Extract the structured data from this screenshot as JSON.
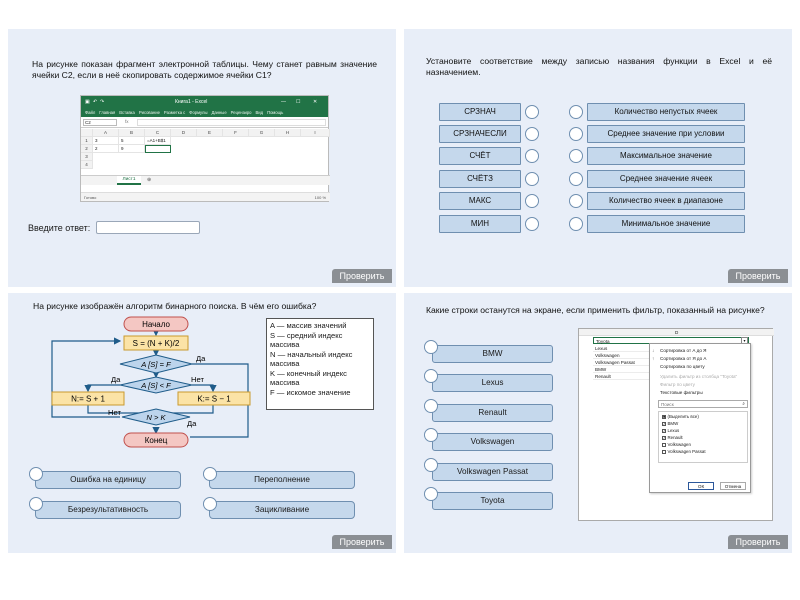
{
  "common": {
    "check_label": "Проверить"
  },
  "task1": {
    "question": "На рисунке показан фрагмент электронной таблицы. Чему станет равным значение ячейки C2, если в неё скопировать содержимое ячейки C1?",
    "excel": {
      "title": "Книга1 - Excel",
      "ribbon": [
        "Файл",
        "Главная",
        "Вставка",
        "Рисование",
        "Разметка с",
        "Формулы",
        "Данные",
        "Рецензиро",
        "Вид",
        "Помощь"
      ],
      "namebox": "C2",
      "fx": "fx",
      "columns": [
        "A",
        "B",
        "C",
        "D",
        "E",
        "F",
        "G",
        "H",
        "I"
      ],
      "rows": [
        "1",
        "2",
        "3",
        "4"
      ],
      "cells": {
        "a1": "3",
        "b1": "5",
        "c1": "=A1+B$1",
        "a2": "2",
        "b2": "9"
      },
      "sheet_tab": "Лист1",
      "status": "Готово",
      "zoom": "100 %"
    },
    "answer_label": "Введите ответ:",
    "answer_value": ""
  },
  "task2": {
    "question": "Установите соответствие между записью названия функции в Excel и её назначением.",
    "functions": [
      "СРЗНАЧ",
      "СРЗНАЧЕСЛИ",
      "СЧЁТ",
      "СЧЁТЗ",
      "МАКС",
      "МИН"
    ],
    "meanings": [
      "Количество непустых ячеек",
      "Среднее значение при условии",
      "Максимальное значение",
      "Среднее значение ячеек",
      "Количество ячеек в диапазоне",
      "Минимальное значение"
    ]
  },
  "task3": {
    "question": "На рисунке изображён алгоритм бинарного поиска. В чём его ошибка?",
    "flow": {
      "start": "Начало",
      "assign": "S = (N + K)/2",
      "cond1": "A [S] = F",
      "cond2": "A [S] < F",
      "left_assign": "N:= S + 1",
      "right_assign": "K:= S − 1",
      "cond3": "N > K",
      "end": "Конец",
      "yes1": "Да",
      "yes2": "Да",
      "no2": "Нет",
      "no3": "Нет",
      "yes3": "Да"
    },
    "legend": [
      "A — массив значений",
      "S — средний индекс массива",
      "N — начальный индекс массива",
      "K — конечный индекс массива",
      "F — искомое значение"
    ],
    "options": [
      "Ошибка на единицу",
      "Переполнение",
      "Безрезультативность",
      "Зацикливание"
    ]
  },
  "task4": {
    "question": "Какие строки останутся на экране, если применить фильтр, показанный на рисунке?",
    "options": [
      "BMW",
      "Lexus",
      "Renault",
      "Volkswagen",
      "Volkswagen Passat",
      "Toyota"
    ],
    "sheet": {
      "column": "D",
      "header": "Toyota",
      "rows": [
        "Lexus",
        "Volkswagen",
        "Volkswagen Passat",
        "BMW",
        "Renault"
      ]
    },
    "menu": {
      "items": [
        "Сортировка от А до Я",
        "Сортировка от Я до А",
        "Сортировка по цвету",
        "Удалить фильтр из столбца \"Toyota\"",
        "Фильтр по цвету",
        "Текстовые фильтры"
      ],
      "search_placeholder": "Поиск",
      "checks": [
        {
          "label": "(Выделить все)",
          "mark": "■"
        },
        {
          "label": "BMW",
          "mark": "✓"
        },
        {
          "label": "Lexus",
          "mark": "✓"
        },
        {
          "label": "Renault",
          "mark": "✓"
        },
        {
          "label": "Volkswagen",
          "mark": ""
        },
        {
          "label": "Volkswagen Passat",
          "mark": ""
        }
      ],
      "ok": "ОК",
      "cancel": "Отмена"
    }
  }
}
